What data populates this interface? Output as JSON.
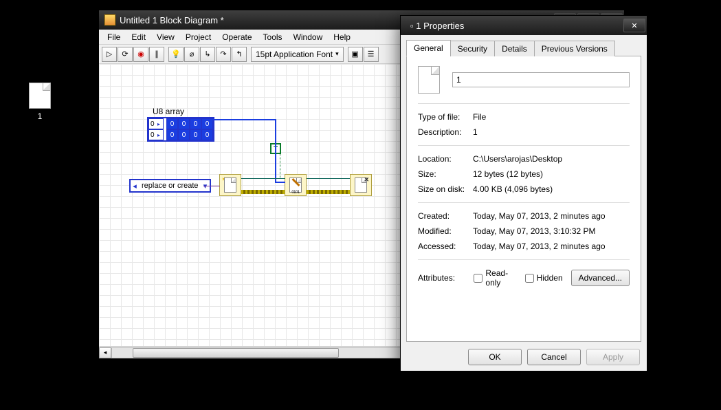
{
  "desktop": {
    "file_label": "1"
  },
  "bd": {
    "title": "Untitled 1 Block Diagram *",
    "menus": [
      "File",
      "Edit",
      "View",
      "Project",
      "Operate",
      "Tools",
      "Window",
      "Help"
    ],
    "font_selector": "15pt Application Font",
    "u8_label": "U8 array",
    "u8_idx": [
      "0",
      "0"
    ],
    "u8_cells": [
      [
        "0",
        "0",
        "0",
        "0"
      ],
      [
        "0",
        "0",
        "0",
        "0"
      ]
    ],
    "true_const": "T",
    "enum_value": "replace or create",
    "write_bits": "0101"
  },
  "props": {
    "title": "1 Properties",
    "tabs": [
      "General",
      "Security",
      "Details",
      "Previous Versions"
    ],
    "filename": "1",
    "rows": {
      "type_k": "Type of file:",
      "type_v": "File",
      "desc_k": "Description:",
      "desc_v": "1",
      "loc_k": "Location:",
      "loc_v": "C:\\Users\\arojas\\Desktop",
      "size_k": "Size:",
      "size_v": "12 bytes (12 bytes)",
      "disk_k": "Size on disk:",
      "disk_v": "4.00 KB (4,096 bytes)",
      "created_k": "Created:",
      "created_v": "Today, May 07, 2013, 2 minutes ago",
      "modified_k": "Modified:",
      "modified_v": "Today, May 07, 2013, 3:10:32 PM",
      "accessed_k": "Accessed:",
      "accessed_v": "Today, May 07, 2013, 2 minutes ago",
      "attr_k": "Attributes:",
      "readonly": "Read-only",
      "hidden": "Hidden",
      "advanced": "Advanced..."
    },
    "buttons": {
      "ok": "OK",
      "cancel": "Cancel",
      "apply": "Apply"
    }
  }
}
